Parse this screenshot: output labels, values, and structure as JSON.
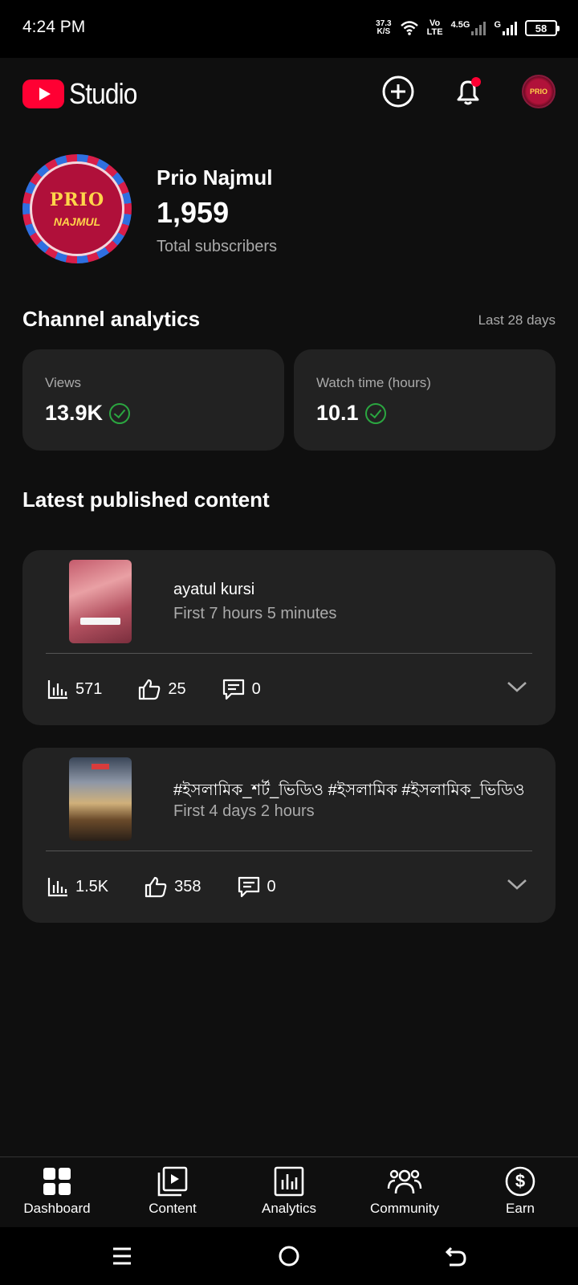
{
  "status_bar": {
    "time": "4:24 PM",
    "net_speed_value": "37.3",
    "net_speed_unit": "K/S",
    "volte_top": "Vo",
    "volte_bottom": "LTE",
    "network_4g": "4.5G",
    "network_g": "G",
    "battery": "58"
  },
  "header": {
    "logo_text": "Studio",
    "avatar_text": "PRIO"
  },
  "profile": {
    "avatar_top": "PRIO",
    "avatar_bottom": "NAJMUL",
    "name": "Prio Najmul",
    "subscribers": "1,959",
    "subscribers_label": "Total subscribers"
  },
  "channel_analytics": {
    "title": "Channel analytics",
    "range": "Last 28 days",
    "cards": [
      {
        "label": "Views",
        "value": "13.9K"
      },
      {
        "label": "Watch time (hours)",
        "value": "10.1"
      }
    ],
    "status_color": "#2ba640"
  },
  "latest_content": {
    "title": "Latest published content",
    "items": [
      {
        "title": "ayatul kursi",
        "subtitle": "First 7 hours 5 minutes",
        "views": "571",
        "likes": "25",
        "comments": "0"
      },
      {
        "title": "#ইসলামিক_শর্ট_ভিডিও #ইসলামিক #ইসলামিক_ভিডিও",
        "subtitle": "First 4 days 2 hours",
        "views": "1.5K",
        "likes": "358",
        "comments": "0"
      }
    ]
  },
  "bottom_nav": {
    "items": [
      {
        "label": "Dashboard",
        "icon": "dashboard-icon"
      },
      {
        "label": "Content",
        "icon": "content-icon"
      },
      {
        "label": "Analytics",
        "icon": "analytics-icon"
      },
      {
        "label": "Community",
        "icon": "community-icon"
      },
      {
        "label": "Earn",
        "icon": "earn-icon"
      }
    ]
  },
  "colors": {
    "brand": "#ff0033",
    "background": "#0f0f0f",
    "card": "#222222",
    "notification_dot": "#ff0033"
  }
}
